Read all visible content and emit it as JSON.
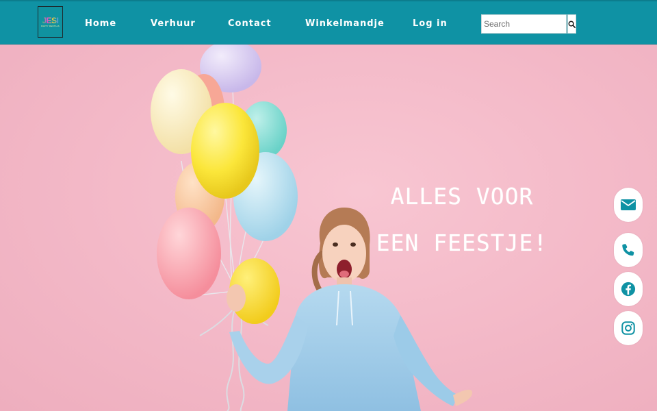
{
  "nav": {
    "logo_text": "JESI",
    "logo_subtext": "PARTY RENTALS",
    "links": [
      "Home",
      "Verhuur",
      "Contact",
      "Winkelmandje",
      "Log in"
    ]
  },
  "search": {
    "placeholder": "Search",
    "icon": "search-icon"
  },
  "hero": {
    "headline_line1": "ALLES VOOR",
    "headline_line2": "EEN FEESTJE!"
  },
  "social": [
    {
      "name": "email",
      "icon": "envelope-icon"
    },
    {
      "name": "phone",
      "icon": "phone-icon"
    },
    {
      "name": "facebook",
      "icon": "facebook-icon"
    },
    {
      "name": "instagram",
      "icon": "instagram-icon"
    }
  ],
  "colors": {
    "nav_bg": "#0f92a4",
    "hero_bg": "#f4bccb",
    "accent": "#0f92a4",
    "text_light": "#ffffff"
  }
}
